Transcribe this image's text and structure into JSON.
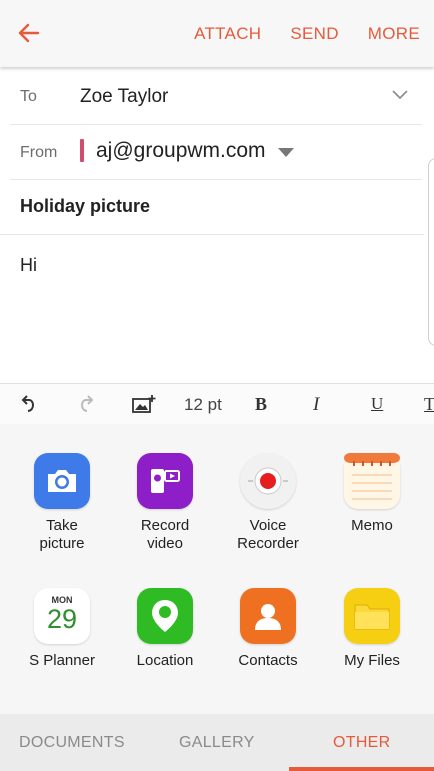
{
  "header": {
    "actions": [
      "ATTACH",
      "SEND",
      "MORE"
    ],
    "accent_color": "#e65a3c"
  },
  "compose": {
    "to_label": "To",
    "to_value": "Zoe Taylor",
    "from_label": "From",
    "from_value": "aj@groupwm.com",
    "subject": "Holiday picture",
    "body": "Hi"
  },
  "toolbar": {
    "font_size": "12 pt",
    "bold": "B",
    "italic": "I",
    "underline": "U",
    "text_color": "T"
  },
  "apps": [
    {
      "label": "Take picture",
      "icon": "camera-icon"
    },
    {
      "label": "Record video",
      "icon": "video-camera-icon"
    },
    {
      "label": "Voice Recorder",
      "icon": "voice-recorder-icon"
    },
    {
      "label": "Memo",
      "icon": "memo-icon"
    },
    {
      "label": "S Planner",
      "icon": "calendar-icon",
      "calendar_month": "MON",
      "calendar_day": "29"
    },
    {
      "label": "Location",
      "icon": "location-pin-icon"
    },
    {
      "label": "Contacts",
      "icon": "contacts-icon"
    },
    {
      "label": "My Files",
      "icon": "folder-icon"
    }
  ],
  "tabs": [
    {
      "label": "DOCUMENTS",
      "selected": false
    },
    {
      "label": "GALLERY",
      "selected": false
    },
    {
      "label": "OTHER",
      "selected": true
    }
  ]
}
